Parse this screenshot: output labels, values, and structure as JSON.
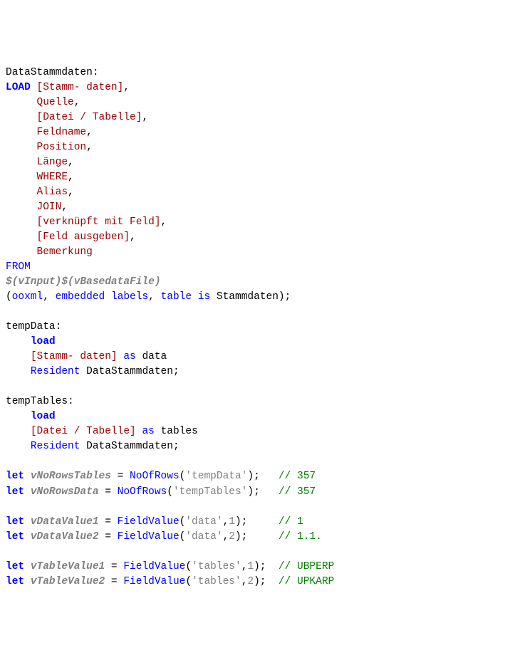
{
  "line1_label": "DataStammdaten:",
  "load_kw": "LOAD",
  "fields": {
    "f1": "[Stamm- daten]",
    "f2": "Quelle",
    "f3": "[Datei / Tabelle]",
    "f4": "Feldname",
    "f5": "Position",
    "f6": "Länge",
    "f7": "WHERE",
    "f8": "Alias",
    "f9": "JOIN",
    "f10": "[verknüpft mit Feld]",
    "f11": "[Feld ausgeben]",
    "f12": "Bemerkung"
  },
  "from_kw": "FROM",
  "source_expr": "$(vInput)$(vBasedataFile)",
  "paren_open": "(",
  "ooxml": "ooxml",
  "emb_lbls": "embedded labels",
  "table_is": "table is",
  "stammdaten": "Stammdaten",
  "close_semi": ");",
  "tempData_label": "tempData:",
  "load2": "load",
  "td_field": "[Stamm- daten]",
  "as_kw": "as",
  "td_alias": "data",
  "resident_kw": "Resident",
  "resident_tbl": "DataStammdaten",
  "semi": ";",
  "tempTables_label": "tempTables:",
  "load3": "load",
  "tt_field": "[Datei / Tabelle]",
  "tt_alias": "tables",
  "let_kw": "let",
  "eq": " = ",
  "vNoRowsTables": "vNoRowsTables",
  "vNoRowsData": "vNoRowsData",
  "vDataValue1": "vDataValue1",
  "vDataValue2": "vDataValue2",
  "vTableValue1": "vTableValue1",
  "vTableValue2": "vTableValue2",
  "NoOfRows": "NoOfRows",
  "FieldValue": "FieldValue",
  "arg_tempData": "'tempData'",
  "arg_tempTables": "'tempTables'",
  "arg_data": "'data'",
  "arg_tables": "'tables'",
  "n1": "1",
  "n2": "2",
  "close_paren_semi": ");",
  "comma": ",",
  "open_paren": "(",
  "close_paren": ")",
  "cmt357a": "// 357",
  "cmt357b": "// 357",
  "cmt1": "// 1",
  "cmt11": "// 1.1.",
  "cmtUBPERP": "// UBPERP",
  "cmtUPKARP": "// UPKARP"
}
